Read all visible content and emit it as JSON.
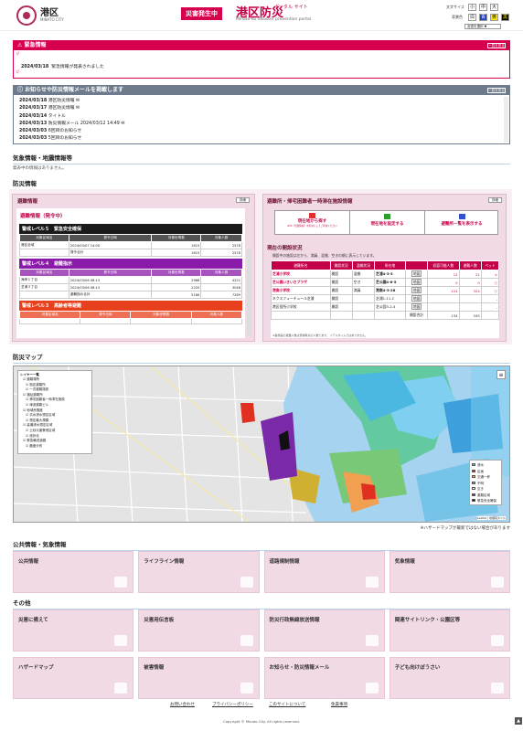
{
  "header": {
    "ward": "港区",
    "ward_sub": "MINATO CITY",
    "disaster_button": "災害発生中",
    "site_title": "港区防災",
    "site_title_sub": "ポータル サイト",
    "site_title_en": "Minato-ku disaster prevention portal",
    "text_size_label": "文字サイズ",
    "text_size_options": [
      "小",
      "中",
      "大"
    ],
    "color_label": "背景色",
    "color_options": [
      "白",
      "青",
      "黄",
      "黒"
    ],
    "language": "言語を選択 ▼"
  },
  "emergency": {
    "title": "緊急情報",
    "more": "一覧を見る",
    "entries": [
      {
        "date": "2024/03/18",
        "text": "緊急情報が発表されました"
      }
    ]
  },
  "mail": {
    "title": "お知らせや防災情報メールを掲載します",
    "more": "一覧を見る",
    "entries": [
      {
        "date": "2024/03/18",
        "text": "港区防災情報 ✉"
      },
      {
        "date": "2024/03/17",
        "text": "港区防災情報 ✉"
      },
      {
        "date": "2024/03/14",
        "text": "タイトル"
      },
      {
        "date": "2024/03/13",
        "text": "防災情報メール 2024/03/12 14:49 ✉"
      },
      {
        "date": "2024/03/03",
        "text": "6回目のお知らせ"
      },
      {
        "date": "2024/03/03",
        "text": "5回目のお知らせ"
      }
    ]
  },
  "weather": {
    "title": "気象情報・地震情報等",
    "message": "発表中の情報はありません。"
  },
  "bousai": {
    "title": "防災情報",
    "evac": {
      "title": "避難情報",
      "detail": "詳細",
      "subtitle": "避難情報（発令中）",
      "cols": [
        "対象区域名",
        "発令日時",
        "対象世帯数",
        "対象人数"
      ],
      "levels": [
        {
          "label": "警戒レベル５　緊急安全確保",
          "color": "#1a1a1a",
          "rows": [
            [
              "港区全域",
              "2024/03/07 14:00",
              "1615",
              "2578"
            ],
            [
              "",
              "発令合計",
              "1615",
              "2578"
            ]
          ]
        },
        {
          "label": "警戒レベル４　避難指示",
          "color": "#8a1aa8",
          "rows": [
            [
              "海岸１丁目",
              "2024/03/06 08:15",
              "2966",
              "4221"
            ],
            [
              "芝浦３丁目",
              "2024/03/06 08:15",
              "2220",
              "3048"
            ],
            [
              "",
              "避難指示合計",
              "5186",
              "7269"
            ]
          ]
        },
        {
          "label": "警戒レベル３　高齢者等避難",
          "color": "#e8401c",
          "rows": [
            [
              "",
              "",
              "",
              ""
            ]
          ]
        }
      ]
    },
    "shelter": {
      "title": "避難所・帰宅困難者一時滞在施設情報",
      "detail": "詳細",
      "btn1": "現在地から探す",
      "btn1_note": "GPS（位置情報）を有効にしてご利用ください",
      "btn2": "現在地を設定する",
      "btn3": "避難所一覧を表示する",
      "status_title": "現在の開設状況",
      "status_note": "開設中の施設は左から、満員、混雑、空きの順に表示しています。",
      "cols": [
        "避難所名",
        "開設状況",
        "混雑状況",
        "所在地",
        "",
        "収容可能人数",
        "避難人数",
        "ペット"
      ],
      "rows": [
        [
          "芝浦小学校",
          "開設",
          "混雑",
          "芝浦4-3-3",
          "地図",
          "12",
          "21",
          "×"
        ],
        [
          "芝公園いきいきプラザ",
          "開設",
          "空き",
          "芝公園4-6-5",
          "地図",
          "0",
          "0",
          "○"
        ],
        [
          "港南小学校",
          "開設",
          "満員",
          "港南4-3-28",
          "地図",
          "124",
          "324",
          "○"
        ],
        [
          "ネクスフューチュール芝浦",
          "開設",
          "",
          "芝浦1-11-2",
          "地図",
          "",
          "",
          "-"
        ],
        [
          "港区役所小学校",
          "開設",
          "",
          "芝公園3-2-4",
          "地図",
          "",
          "",
          "-"
        ],
        [
          "",
          "",
          "",
          "",
          "開設合計",
          "134",
          "345",
          ""
        ]
      ],
      "note": "※各施設の避難人数は登録時点の人数であり、リアルタイムではありません。"
    }
  },
  "map": {
    "title": "防災マップ",
    "layer_title": "レイヤー一覧",
    "layers": [
      "避難場所",
      "指定避難所",
      "一次避難施設",
      "福祉避難所",
      "帰宅困難者一時滞在施設",
      "津波避難ビル",
      "地域危険度",
      "洪水浸水想定区域",
      "想定最大規模",
      "高潮浸水想定区域",
      "土砂災害警戒区域",
      "液状化",
      "緊急輸送道路",
      "震度分布"
    ],
    "legend": [
      "浸水",
      "区画",
      "交通一杯",
      "不明",
      "空き",
      "避難区域",
      "緊急安全確保"
    ],
    "attribution": "Leaflet | 地理院タイル",
    "disclaimer": "※ハザードマップが最新ではない場合があります"
  },
  "public": {
    "title": "公共情報・気象情報",
    "cards": [
      "公共情報",
      "ライフライン情報",
      "道路規制情報",
      "気象情報"
    ]
  },
  "other": {
    "title": "その他",
    "cards": [
      "災害に備えて",
      "災害用伝言板",
      "防災行政無線放送情報",
      "関連サイトリンク・公園区等",
      "ハザードマップ",
      "被害情報",
      "お知らせ・防災情報メール",
      "子ども向けぼうさい"
    ]
  },
  "footer": {
    "links": [
      "お問い合わせ",
      "プライバシーポリシー",
      "このサイトについて",
      "免責事項"
    ],
    "copyright": "Copyright © Minato City. All rights reserved."
  },
  "colors": {
    "emergency": "#d7004f",
    "mail_bar": "#6d7b8c",
    "pane": "#f2d9e6",
    "accent": "#c4004a"
  }
}
